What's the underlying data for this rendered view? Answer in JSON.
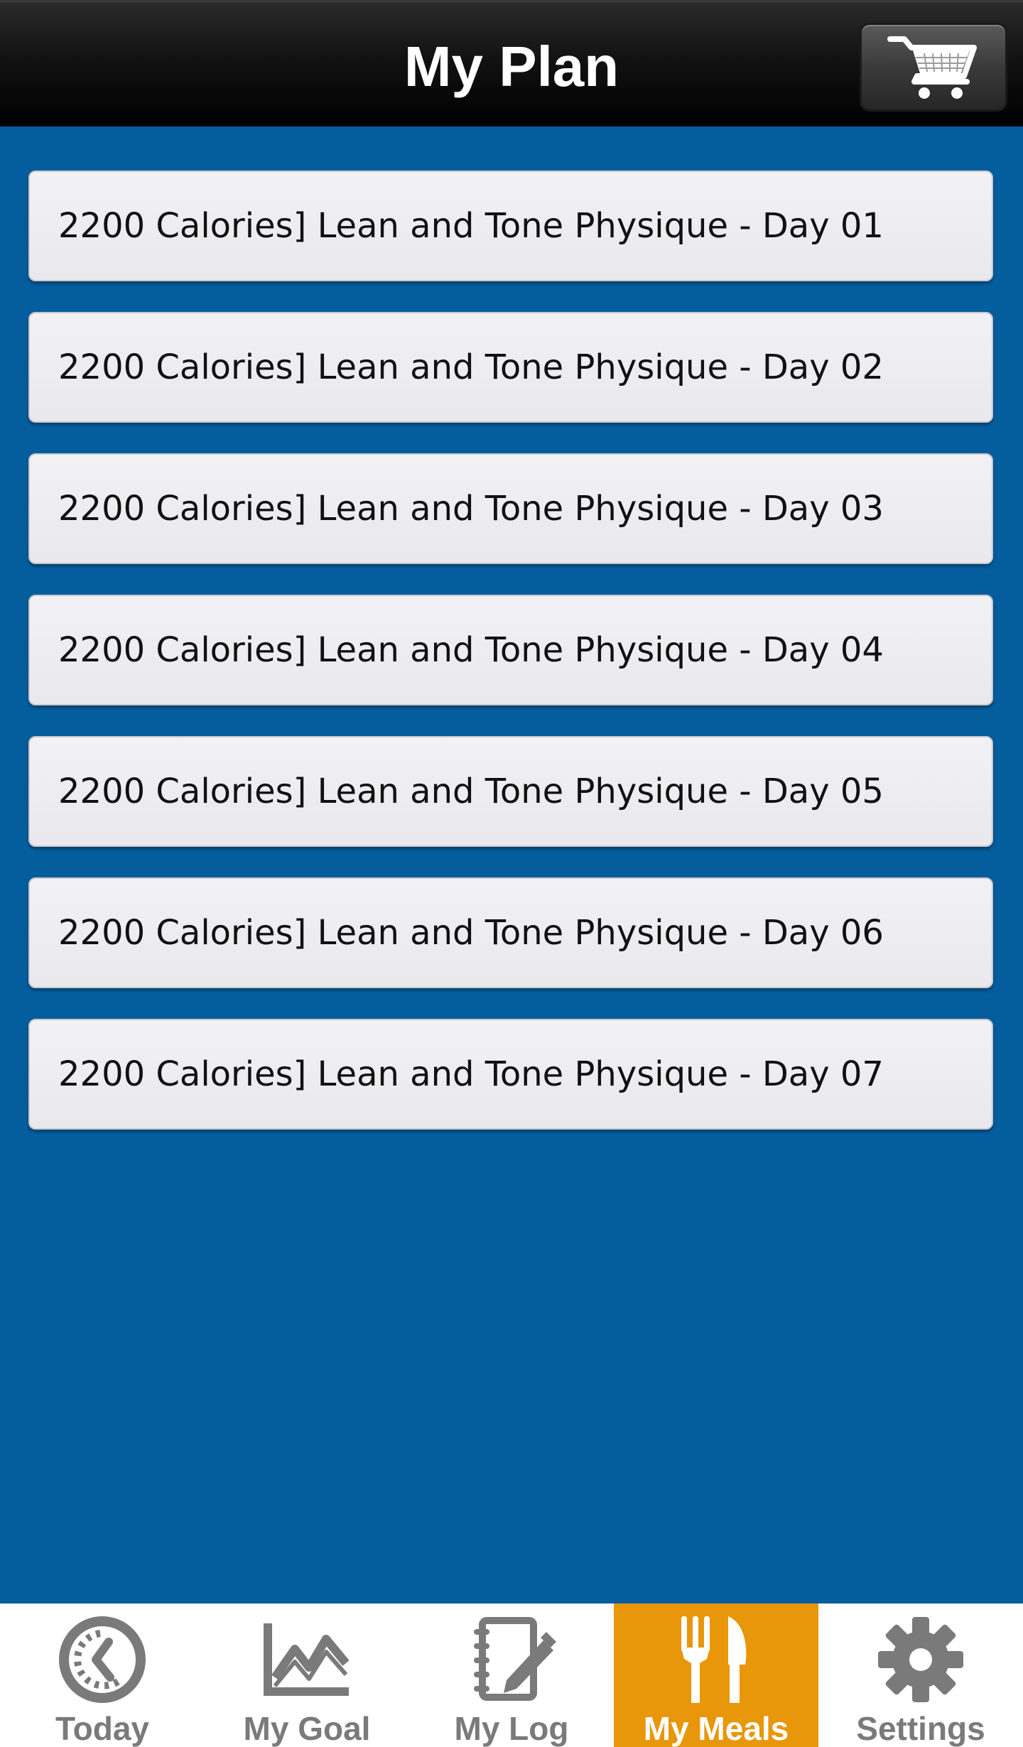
{
  "header": {
    "title": "My Plan",
    "cart_icon": "shopping-cart-icon"
  },
  "plans": [
    {
      "label": "2200 Calories] Lean and Tone Physique - Day 01"
    },
    {
      "label": "2200 Calories] Lean and Tone Physique - Day 02"
    },
    {
      "label": "2200 Calories] Lean and Tone Physique - Day 03"
    },
    {
      "label": "2200 Calories] Lean and Tone Physique - Day 04"
    },
    {
      "label": "2200 Calories] Lean and Tone Physique - Day 05"
    },
    {
      "label": "2200 Calories] Lean and Tone Physique - Day 06"
    },
    {
      "label": "2200 Calories] Lean and Tone Physique - Day 07"
    }
  ],
  "tabs": [
    {
      "label": "Today",
      "icon": "clock-icon",
      "active": false
    },
    {
      "label": "My Goal",
      "icon": "chart-line-icon",
      "active": false
    },
    {
      "label": "My Log",
      "icon": "notebook-pencil-icon",
      "active": false
    },
    {
      "label": "My Meals",
      "icon": "fork-knife-icon",
      "active": true
    },
    {
      "label": "Settings",
      "icon": "gear-icon",
      "active": false
    }
  ],
  "colors": {
    "background": "#045d9d",
    "header": "#000000",
    "active_tab": "#e8960a",
    "inactive_tab_text": "#7a7a7a"
  }
}
